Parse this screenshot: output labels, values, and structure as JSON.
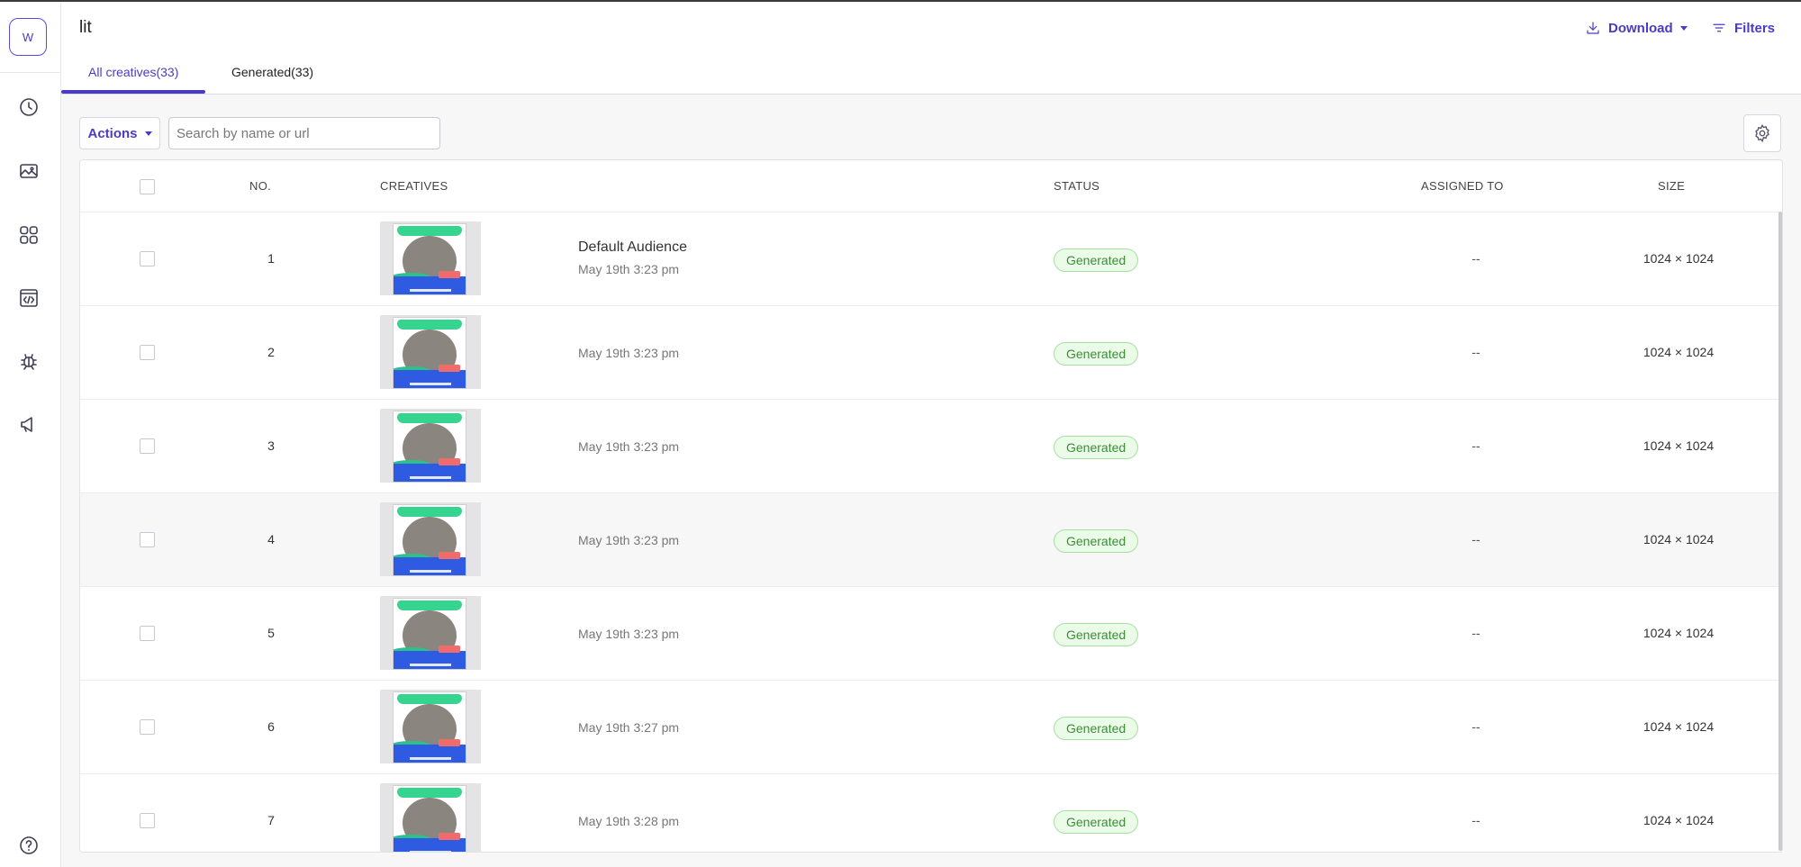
{
  "sidebar": {
    "avatar_letter": "W",
    "icons": [
      "clock-icon",
      "image-icon",
      "apps-grid-icon",
      "code-window-icon",
      "bug-icon",
      "megaphone-icon",
      "help-icon"
    ]
  },
  "header": {
    "title": "lit",
    "download_label": "Download",
    "filters_label": "Filters",
    "tabs": [
      {
        "label": "All creatives(33)",
        "active": true
      },
      {
        "label": "Generated(33)",
        "active": false
      }
    ]
  },
  "toolbar": {
    "actions_label": "Actions",
    "search_placeholder": "Search by name or url",
    "search_value": ""
  },
  "table": {
    "columns": {
      "no": "NO.",
      "creatives": "CREATIVES",
      "status": "STATUS",
      "assigned": "ASSIGNED TO",
      "size": "SIZE"
    },
    "rows": [
      {
        "no": "1",
        "title": "Default Audience",
        "date": "May 19th 3:23 pm",
        "status": "Generated",
        "assigned": "--",
        "size": "1024 × 1024"
      },
      {
        "no": "2",
        "title": "",
        "date": "May 19th 3:23 pm",
        "status": "Generated",
        "assigned": "--",
        "size": "1024 × 1024"
      },
      {
        "no": "3",
        "title": "",
        "date": "May 19th 3:23 pm",
        "status": "Generated",
        "assigned": "--",
        "size": "1024 × 1024"
      },
      {
        "no": "4",
        "title": "",
        "date": "May 19th 3:23 pm",
        "status": "Generated",
        "assigned": "--",
        "size": "1024 × 1024"
      },
      {
        "no": "5",
        "title": "",
        "date": "May 19th 3:23 pm",
        "status": "Generated",
        "assigned": "--",
        "size": "1024 × 1024"
      },
      {
        "no": "6",
        "title": "",
        "date": "May 19th 3:27 pm",
        "status": "Generated",
        "assigned": "--",
        "size": "1024 × 1024"
      },
      {
        "no": "7",
        "title": "",
        "date": "May 19th 3:28 pm",
        "status": "Generated",
        "assigned": "--",
        "size": "1024 × 1024"
      }
    ]
  },
  "colors": {
    "accent": "#4a3cc2",
    "status_generated_bg": "#eafbe8",
    "status_generated_text": "#3f8b3a"
  }
}
